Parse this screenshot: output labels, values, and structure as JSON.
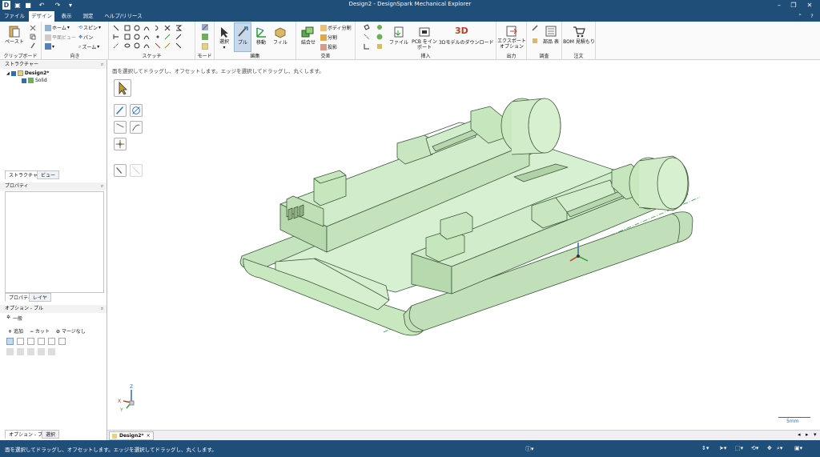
{
  "titlebar": {
    "title": "Design2 - DesignSpark Mechanical Explorer",
    "help": "?"
  },
  "tabs": [
    "ファイル",
    "デザイン",
    "表示",
    "測定",
    "ヘルプ/リリース"
  ],
  "active_tab": 1,
  "ribbon": {
    "clipboard": {
      "label": "クリップボード",
      "paste": "ペースト"
    },
    "orient": {
      "label": "向き",
      "home": "ホーム",
      "plane_view": "平面ビュー",
      "spin": "スピン",
      "pan": "パン",
      "zoom": "ズーム"
    },
    "sketch": {
      "label": "スケッチ"
    },
    "mode": {
      "label": "モード"
    },
    "edit": {
      "label": "編集",
      "select": "選択",
      "pull": "プル",
      "move": "移動",
      "fill": "フィル"
    },
    "intersect": {
      "label": "交差",
      "combine": "結合せ",
      "split_body": "ボディ分割",
      "split": "分割",
      "project": "投影"
    },
    "insert": {
      "label": "挿入",
      "file": "ファイル",
      "pcb": "PCB をイン ポート",
      "dl3d": "3Dモデルのダウンロード",
      "dl3d_icon": "3D"
    },
    "output": {
      "label": "出力",
      "export": "エクスポート オプション"
    },
    "inspect": {
      "label": "調査",
      "parts": "部品 表"
    },
    "order": {
      "label": "注文",
      "bom": "BOM 見積もり"
    }
  },
  "structure": {
    "title": "ストラクチャー",
    "root": "Design2*",
    "child": "Solid"
  },
  "structure_tabs": [
    "ストラクチャー",
    "ビュー"
  ],
  "properties": {
    "title": "プロパティ"
  },
  "prop_tabs": [
    "プロパティ",
    "レイヤ"
  ],
  "options": {
    "title": "オプション - プル",
    "general": "一般",
    "add": "追加",
    "cut": "カット",
    "no_merge": "マージなし"
  },
  "bottom_tabs": [
    "オプション - プル",
    "選択"
  ],
  "canvas": {
    "hint": "面を選択してドラッグし、オフセットします。エッジを選択してドラッグし、丸くします。",
    "scale": "5mm"
  },
  "axes": {
    "x": "X",
    "y": "Y",
    "z": "Z"
  },
  "doc_tab": {
    "name": "Design2*",
    "close": "×"
  },
  "status": {
    "text": "面を選択してドラッグし、オフセットします。エッジを選択してドラッグし、丸くします。"
  },
  "colors": {
    "title_bar": "#1f4e79",
    "model_fill": "#cfe8c9",
    "model_stroke": "#3f5a3d",
    "axis_line": "#2a9d3a"
  }
}
